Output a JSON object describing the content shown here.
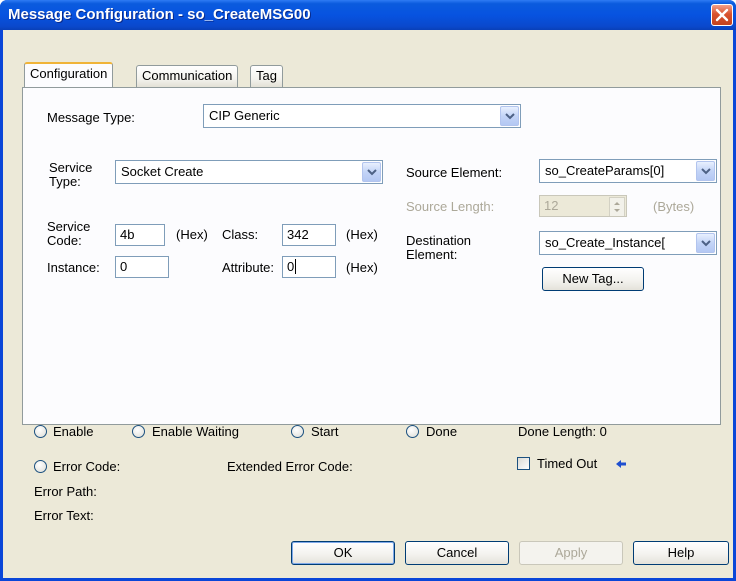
{
  "window": {
    "title": "Message Configuration - so_CreateMSG00"
  },
  "tabs": [
    {
      "label": "Configuration",
      "active": true
    },
    {
      "label": "Communication",
      "active": false
    },
    {
      "label": "Tag",
      "active": false
    }
  ],
  "config": {
    "message_type_label": "Message Type:",
    "message_type_value": "CIP Generic",
    "service_type_label_1": "Service",
    "service_type_label_2": "Type:",
    "service_type_value": "Socket Create",
    "service_code_label_1": "Service",
    "service_code_label_2": "Code:",
    "service_code_value": "4b",
    "hex_unit": "(Hex)",
    "class_label": "Class:",
    "class_value": "342",
    "instance_label": "Instance:",
    "instance_value": "0",
    "attribute_label": "Attribute:",
    "attribute_value": "0",
    "source_element_label": "Source Element:",
    "source_element_value": "so_CreateParams[0]",
    "source_length_label": "Source Length:",
    "source_length_value": "12",
    "bytes_unit": "(Bytes)",
    "destination_label_1": "Destination",
    "destination_label_2": "Element:",
    "destination_value": "so_Create_Instance[",
    "new_tag_label": "New Tag..."
  },
  "status": {
    "enable": "Enable",
    "enable_waiting": "Enable Waiting",
    "start": "Start",
    "done": "Done",
    "done_length": "Done Length: 0",
    "error_code": "Error Code:",
    "extended_error_code": "Extended Error Code:",
    "timed_out": "Timed Out",
    "error_path": "Error Path:",
    "error_text": "Error Text:"
  },
  "buttons": {
    "ok": "OK",
    "cancel": "Cancel",
    "apply": "Apply",
    "help": "Help"
  },
  "icons": {
    "close": "close-icon",
    "dropdown": "chevron-down-icon",
    "spin": "spin-arrows-icon",
    "timed_out_indicator": "arrow-left-icon"
  },
  "colors": {
    "titlebar": "#0a53e0",
    "dialog_bg": "#ece9d8",
    "panel_bg": "#fcfcfe",
    "close_red": "#d9532f",
    "indicator_blue": "#1f4fcf"
  }
}
